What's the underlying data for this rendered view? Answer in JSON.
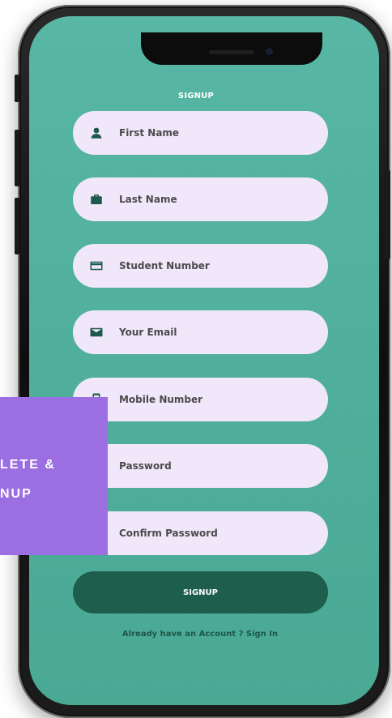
{
  "screen": {
    "title": "SIGNUP"
  },
  "fields": [
    {
      "label": "First Name",
      "icon": "person-icon"
    },
    {
      "label": "Last Name",
      "icon": "briefcase-icon"
    },
    {
      "label": "Student Number",
      "icon": "card-icon"
    },
    {
      "label": "Your Email",
      "icon": "email-icon"
    },
    {
      "label": "Mobile Number",
      "icon": "phone-icon"
    },
    {
      "label": "Password",
      "icon": "lock-icon"
    },
    {
      "label": "Confirm Password",
      "icon": "lock-icon"
    }
  ],
  "actions": {
    "signup_label": "SIGNUP",
    "signin_text": "Already have an Account ? Sign In"
  },
  "overlay": {
    "line1": "LETE &",
    "line2": "NUP"
  },
  "colors": {
    "screen_background": "#54b3a0",
    "field_background": "#f1e7fb",
    "button_background": "#1e5e4c",
    "overlay_background": "#9b6fe2",
    "icon_color": "#1d5a4b"
  }
}
